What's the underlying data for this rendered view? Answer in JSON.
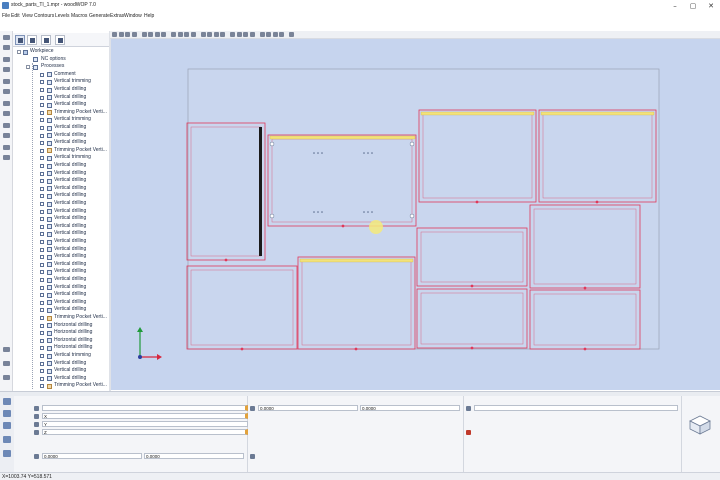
{
  "window": {
    "title": "stock_parts_TI_1.mpr - woodWOP 7.0",
    "controls": {
      "minimize": "–",
      "maximize": "▢",
      "close": "✕"
    }
  },
  "menu": [
    "File",
    "Edit",
    "View",
    "Contours",
    "Levels",
    "Macros",
    "Generate",
    "Extras",
    "Window",
    "Help"
  ],
  "tree": {
    "root": "Workpiece",
    "nc_options": "NC options",
    "processes_label": "Processes",
    "items": [
      {
        "label": "Comment",
        "type": "comment"
      },
      {
        "label": "Vertical trimming",
        "type": "op"
      },
      {
        "label": "Vertical drilling",
        "type": "op"
      },
      {
        "label": "Vertical drilling",
        "type": "op"
      },
      {
        "label": "Vertical drilling",
        "type": "op"
      },
      {
        "label": "Trimming Pocket Verti...",
        "type": "pocket"
      },
      {
        "label": "Vertical trimming",
        "type": "op"
      },
      {
        "label": "Vertical drilling",
        "type": "op"
      },
      {
        "label": "Vertical drilling",
        "type": "op"
      },
      {
        "label": "Vertical drilling",
        "type": "op"
      },
      {
        "label": "Trimming Pocket Verti...",
        "type": "pocket"
      },
      {
        "label": "Vertical trimming",
        "type": "op"
      },
      {
        "label": "Vertical drilling",
        "type": "op"
      },
      {
        "label": "Vertical drilling",
        "type": "op"
      },
      {
        "label": "Vertical drilling",
        "type": "op"
      },
      {
        "label": "Vertical drilling",
        "type": "op"
      },
      {
        "label": "Vertical drilling",
        "type": "op"
      },
      {
        "label": "Vertical drilling",
        "type": "op"
      },
      {
        "label": "Vertical drilling",
        "type": "op"
      },
      {
        "label": "Vertical drilling",
        "type": "op"
      },
      {
        "label": "Vertical drilling",
        "type": "op"
      },
      {
        "label": "Vertical drilling",
        "type": "op"
      },
      {
        "label": "Vertical drilling",
        "type": "op"
      },
      {
        "label": "Vertical drilling",
        "type": "op"
      },
      {
        "label": "Vertical drilling",
        "type": "op"
      },
      {
        "label": "Vertical drilling",
        "type": "op"
      },
      {
        "label": "Vertical drilling",
        "type": "op"
      },
      {
        "label": "Vertical drilling",
        "type": "op"
      },
      {
        "label": "Vertical drilling",
        "type": "op"
      },
      {
        "label": "Vertical drilling",
        "type": "op"
      },
      {
        "label": "Vertical drilling",
        "type": "op"
      },
      {
        "label": "Vertical drilling",
        "type": "op"
      },
      {
        "label": "Trimming Pocket Verti...",
        "type": "pocket"
      },
      {
        "label": "Horizontal drilling",
        "type": "op"
      },
      {
        "label": "Horizontal drilling",
        "type": "op"
      },
      {
        "label": "Horizontal drilling",
        "type": "op"
      },
      {
        "label": "Horizontal drilling",
        "type": "op"
      },
      {
        "label": "Vertical trimming",
        "type": "op"
      },
      {
        "label": "Vertical drilling",
        "type": "op"
      },
      {
        "label": "Vertical drilling",
        "type": "op"
      },
      {
        "label": "Vertical drilling",
        "type": "op"
      },
      {
        "label": "Trimming Pocket Verti...",
        "type": "pocket"
      }
    ]
  },
  "bottom": {
    "fields": [
      {
        "label": "",
        "value": ""
      },
      {
        "label": "",
        "value": "X"
      },
      {
        "label": "",
        "value": "Y"
      },
      {
        "label": "",
        "value": "Z"
      }
    ],
    "mid_fields": [
      {
        "value": "0.0000"
      },
      {
        "value": "0.0000"
      }
    ],
    "lower_fields": [
      {
        "value": "0.0000"
      },
      {
        "value": "0.0000"
      }
    ]
  },
  "status": {
    "coords": "X=1003.74 Y=518.571"
  },
  "colors": {
    "canvas_bg": "#c6d4ee",
    "part_outline": "#e0395a",
    "machining_table": "#c9d6ee",
    "workpiece_border": "#9aa3b5"
  }
}
